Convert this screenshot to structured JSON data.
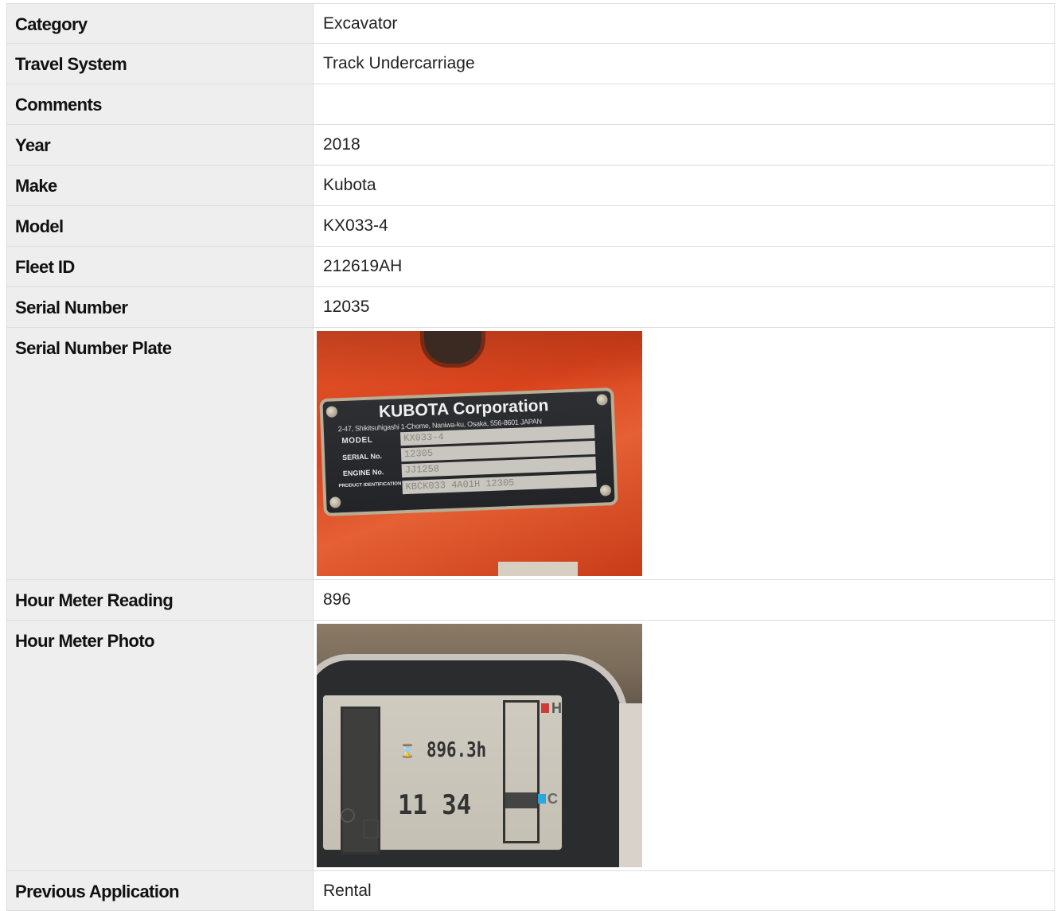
{
  "rows": [
    {
      "label": "Category",
      "value": "Excavator"
    },
    {
      "label": "Travel System",
      "value": "Track Undercarriage"
    },
    {
      "label": "Comments",
      "value": ""
    },
    {
      "label": "Year",
      "value": "2018"
    },
    {
      "label": "Make",
      "value": "Kubota"
    },
    {
      "label": "Model",
      "value": "KX033-4"
    },
    {
      "label": "Fleet ID",
      "value": "212619AH"
    },
    {
      "label": "Serial Number",
      "value": "12035"
    },
    {
      "label": "Serial Number Plate",
      "value": null
    },
    {
      "label": "Hour Meter Reading",
      "value": "896"
    },
    {
      "label": "Hour Meter Photo",
      "value": null
    },
    {
      "label": "Previous Application",
      "value": "Rental"
    }
  ],
  "serial_plate": {
    "brand": "KUBOTA Corporation",
    "address": "2-47, Shikitsuhigashi 1-Chome, Naniwa-ku, Osaka, 556-8601 JAPAN",
    "model_label": "MODEL",
    "model_value": "KX033-4",
    "serial_label": "SERIAL No.",
    "serial_value": "12305",
    "engine_label": "ENGINE No.",
    "engine_value": "JJ1258",
    "pin_label": "PRODUCT IDENTIFICATION NUMBER",
    "pin_value": "KBCK033 4A01H 12305"
  },
  "hour_meter": {
    "hours": "896.3h",
    "clock": "11 34",
    "hot_label": "H",
    "cold_label": "C",
    "hot_color": "#d23a3a",
    "cold_color": "#2aa7e0"
  }
}
